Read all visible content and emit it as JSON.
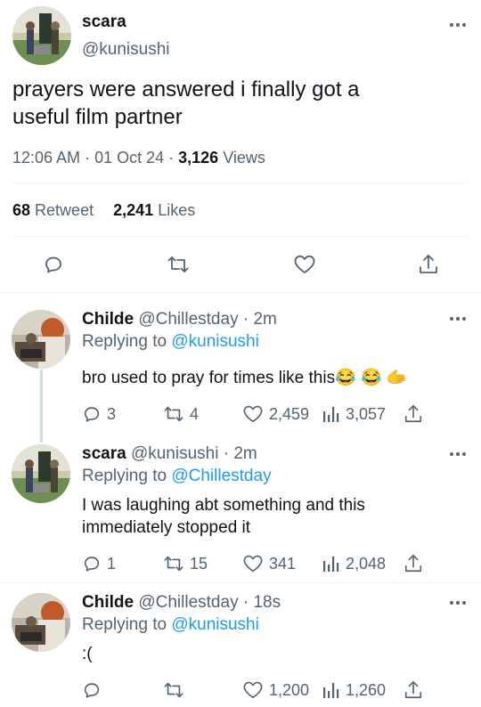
{
  "main_tweet": {
    "display_name": "scara",
    "handle": "@kunisushi",
    "text_line1": "prayers were answered i finally got a",
    "text_line2": "useful film partner",
    "time": "12:06 AM",
    "date": "01 Oct 24",
    "views_count": "3,126",
    "views_label": "Views",
    "retweet_count": "68",
    "retweet_label": "Retweet",
    "likes_count": "2,241",
    "likes_label": "Likes"
  },
  "replies": [
    {
      "display_name": "Childe",
      "handle": "@Chillestday",
      "age": "· 2m",
      "replying_label": "Replying to",
      "replying_handle": "@kunisushi",
      "text_line1": "bro used to pray for times like this😂 😂 🫱",
      "text_line2": "",
      "reply_count": "3",
      "retweet_count": "4",
      "like_count": "2,459",
      "view_count": "3,057"
    },
    {
      "display_name": "scara",
      "handle": "@kunisushi",
      "age": "· 2m",
      "replying_label": "Replying to",
      "replying_handle": "@Chillestday",
      "text_line1": "I was laughing abt something and this",
      "text_line2": "immediately stopped it",
      "reply_count": "1",
      "retweet_count": "15",
      "like_count": "341",
      "view_count": "2,048"
    },
    {
      "display_name": "Childe",
      "handle": "@Chillestday",
      "age": "· 18s",
      "replying_label": "Replying to",
      "replying_handle": "@kunisushi",
      "text_line1": ":(",
      "text_line2": "",
      "reply_count": "",
      "retweet_count": "",
      "like_count": "1,200",
      "view_count": "1,260"
    }
  ],
  "colors": {
    "accent": "#1d9bf0",
    "text": "#0f1419",
    "muted": "#536471",
    "divider": "#eff3f4"
  }
}
